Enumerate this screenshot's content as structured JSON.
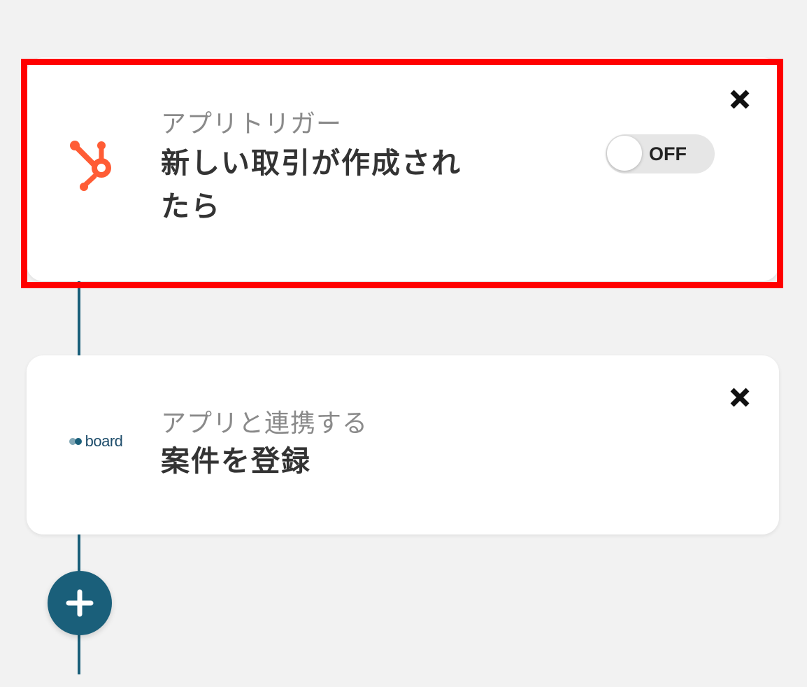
{
  "colors": {
    "accent": "#1a5f7a",
    "highlight": "#ff0000",
    "hubspot": "#ff5c35",
    "background": "#f2f2f2",
    "card": "#ffffff"
  },
  "flow": {
    "trigger": {
      "icon": "hubspot-icon",
      "category": "アプリトリガー",
      "title_line1": "新しい取引が作成され",
      "title_line2": "たら",
      "toggle_label": "OFF"
    },
    "action": {
      "icon": "board-logo",
      "logo_text": "board",
      "category": "アプリと連携する",
      "title": "案件を登録"
    },
    "add_button_icon": "plus-icon"
  }
}
